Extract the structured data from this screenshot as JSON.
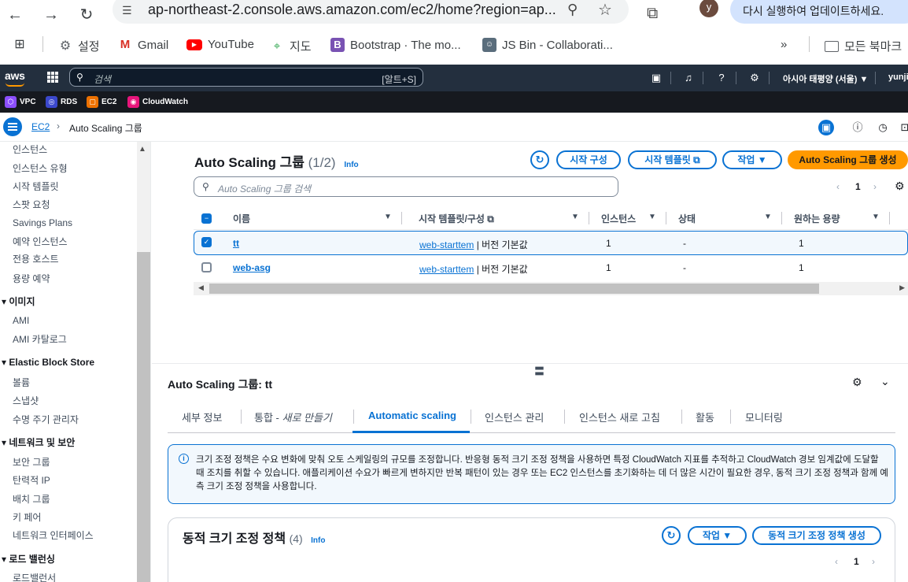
{
  "browser": {
    "url": "ap-northeast-2.console.aws.amazon.com/ec2/home?region=ap...",
    "profile_initial": "y",
    "update_label": "다시 실행하여 업데이트하세요.",
    "bookmarks": [
      {
        "label": "설정"
      },
      {
        "label": "Gmail"
      },
      {
        "label": "YouTube"
      },
      {
        "label": "지도"
      },
      {
        "label": "Bootstrap · The mo..."
      },
      {
        "label": "JS Bin - Collaborati..."
      }
    ],
    "bookmarks_more": "»",
    "all_bookmarks": "모든 북마크"
  },
  "aws": {
    "logo": "aws",
    "search_placeholder": "검색",
    "search_shortcut": "[알트+S]",
    "region": "아시아 태평양 (서울) ▼",
    "user": "yunji",
    "favorites": [
      {
        "label": "VPC",
        "color": "#8c4fff"
      },
      {
        "label": "RDS",
        "color": "#3b48cc"
      },
      {
        "label": "EC2",
        "color": "#ed7100"
      },
      {
        "label": "CloudWatch",
        "color": "#e7157b"
      }
    ]
  },
  "breadcrumb": {
    "root": "EC2",
    "current": "Auto Scaling 그룹"
  },
  "sidebar": {
    "items_a": [
      "인스턴스",
      "인스턴스 유형",
      "시작 템플릿",
      "스팟 요청",
      "Savings Plans",
      "예약 인스턴스",
      "전용 호스트",
      "용량 예약"
    ],
    "section_images": "이미지",
    "items_images": [
      "AMI",
      "AMI 카탈로그"
    ],
    "section_ebs": "Elastic Block Store",
    "items_ebs": [
      "볼륨",
      "스냅샷",
      "수명 주기 관리자"
    ],
    "section_net": "네트워크 및 보안",
    "items_net": [
      "보안 그룹",
      "탄력적 IP",
      "배치 그룹",
      "키 페어",
      "네트워크 인터페이스"
    ],
    "section_lb": "로드 밸런싱",
    "items_lb": [
      "로드밸런서"
    ]
  },
  "list": {
    "title": "Auto Scaling 그룹",
    "count": "(1/2)",
    "info": "Info",
    "btn_launch_config": "시작 구성",
    "btn_launch_template": "시작 템플릿",
    "btn_actions": "작업",
    "btn_create": "Auto Scaling 그룹 생성",
    "search_placeholder": "Auto Scaling 그룹 검색",
    "page": "1",
    "columns": [
      "이름",
      "시작 템플릿/구성",
      "인스턴스",
      "상태",
      "원하는 용량"
    ],
    "rows": [
      {
        "name": "tt",
        "template": "web-starttem",
        "version": " | 버전 기본값",
        "instances": "1",
        "status": "-",
        "desired": "1",
        "selected": true
      },
      {
        "name": "web-asg",
        "template": "web-starttem",
        "version": " | 버전 기본값",
        "instances": "1",
        "status": "-",
        "desired": "1",
        "selected": false
      }
    ]
  },
  "detail": {
    "title": "Auto Scaling 그룹: tt",
    "tabs": [
      {
        "label": "세부 정보"
      },
      {
        "label": "통합 - ",
        "italic": "새로 만들기"
      },
      {
        "label": "Automatic scaling"
      },
      {
        "label": "인스턴스 관리"
      },
      {
        "label": "인스턴스 새로 고침"
      },
      {
        "label": "활동"
      },
      {
        "label": "모니터링"
      }
    ],
    "active_tab": "Automatic scaling",
    "alert": "크기 조정 정책은 수요 변화에 맞춰 오토 스케일링의 규모를 조정합니다. 반응형 동적 크기 조정 정책을 사용하면 특정 CloudWatch 지표를 추적하고 CloudWatch 경보 임계값에 도달할 때 조치를 취할 수 있습니다. 애플리케이션 수요가 빠르게 변하지만 반복 패턴이 있는 경우 또는 EC2 인스턴스를 초기화하는 데 더 많은 시간이 필요한 경우, 동적 크기 조정 정책과 함께 예측 크기 조정 정책을 사용합니다.",
    "policy_title": "동적 크기 조정 정책",
    "policy_count": "(4)",
    "policy_info": "Info",
    "policy_actions": "작업",
    "policy_create": "동적 크기 조정 정책 생성",
    "policy_page": "1"
  }
}
